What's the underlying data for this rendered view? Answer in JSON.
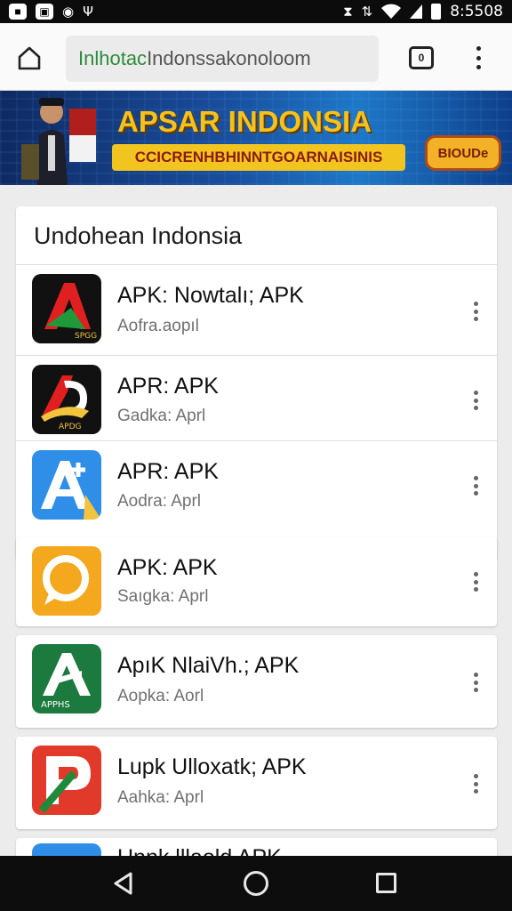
{
  "status_bar": {
    "left_icons": [
      "image-icon",
      "gallery-icon",
      "sync-icon",
      "usb-icon"
    ],
    "right_icons": [
      "vibrate-icon",
      "data-icon",
      "wifi-icon",
      "signal-icon",
      "battery-icon"
    ],
    "time": "8:5508"
  },
  "browser": {
    "url_secure": "Inlhotac",
    "url_rest": " Indonssakonoloom",
    "tab_count": "0"
  },
  "banner": {
    "title": "APSAR INDONSIA",
    "subtitle": "CCICRENHBHINNTGOARNAISINIS",
    "badge": "BIOUDe"
  },
  "section": {
    "title": "Undohean Indonsia"
  },
  "apps": [
    {
      "name": "APK: Nowtalı; APK",
      "sub": "Aofra.aopıl",
      "icon": "a-logo-black-red-green",
      "icon_text": "SPGG"
    },
    {
      "name": "APR: APK",
      "sub": "Gadka: Aprl",
      "icon": "a-logo-black-white-yellow",
      "icon_text": "APDG"
    },
    {
      "name": "APR: APK",
      "sub": "Aodra: Aprl",
      "icon": "a-logo-blue-white",
      "icon_text": ""
    },
    {
      "name": "APK: APK",
      "sub": "Saıgka: Aprl",
      "icon": "speech-bubble-orange",
      "icon_text": ""
    },
    {
      "name": "ApıK NlaiVh.; APK",
      "sub": "Aopka: Aorl",
      "icon": "a-logo-green-white",
      "icon_text": "APPHS"
    },
    {
      "name": "Lupk Ulloxatk; APK",
      "sub": "Aahka: Aprl",
      "icon": "p-logo-red",
      "icon_text": ""
    },
    {
      "name": "Unnk lllaold APK",
      "sub": "",
      "icon": "blue-partial",
      "icon_text": ""
    }
  ],
  "colors": {
    "banner_title": "#f4c21d",
    "url_secure": "#2e8b3c",
    "nav_bar": "#0d0d0d"
  }
}
